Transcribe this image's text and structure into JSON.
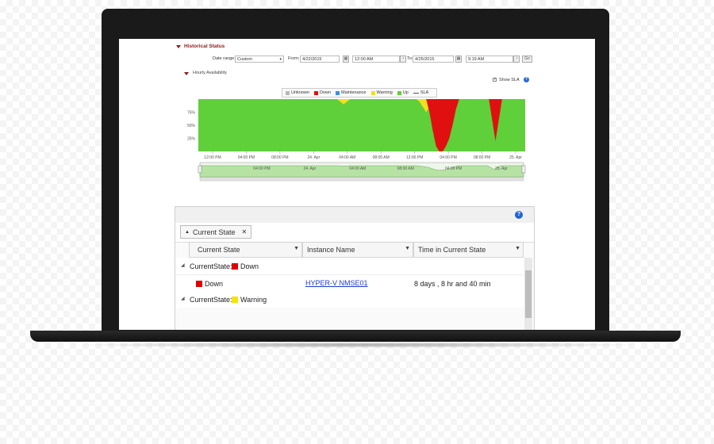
{
  "historical_status": {
    "title": "Historical Status",
    "date_range_label": "Date range:",
    "date_range_value": "Custom",
    "from_label": "From:",
    "from_date": "4/22/2015",
    "from_time": "12:00 AM",
    "to_label": "To:",
    "to_date": "4/25/2015",
    "to_time": "9:19 AM",
    "go_label": "Go"
  },
  "hourly_availability": {
    "title": "Hourly Availability",
    "show_sla_label": "Show SLA",
    "show_sla_checked": true,
    "help_icon": "?"
  },
  "chart_data": {
    "type": "area",
    "legend": [
      {
        "name": "Unknown",
        "color": "#b8b8b8"
      },
      {
        "name": "Down",
        "color": "#e01010"
      },
      {
        "name": "Maintenance",
        "color": "#3a8ee6"
      },
      {
        "name": "Warning",
        "color": "#f0e020"
      },
      {
        "name": "Up",
        "color": "#5fcf3a"
      },
      {
        "name": "SLA",
        "color": "#555555"
      }
    ],
    "y_ticks": [
      "75%",
      "50%",
      "25%"
    ],
    "ylim": [
      0,
      100
    ],
    "x_ticks": [
      "12:00 PM",
      "04:00 PM",
      "08:00 PM",
      "24. Apr",
      "04:00 AM",
      "08:00 AM",
      "12:00 PM",
      "04:00 PM",
      "08:00 PM",
      "25. Apr"
    ],
    "navigator_ticks": [
      "04:00 PM",
      "24. Apr",
      "04:00 AM",
      "08:00 AM",
      "04:00 PM",
      "25. Apr"
    ],
    "series": [
      {
        "name": "Up",
        "values": [
          100,
          100,
          100,
          100,
          100,
          100,
          100,
          100,
          100,
          100,
          100,
          100,
          100,
          100,
          100,
          100,
          100,
          100,
          100,
          100,
          100,
          100,
          100,
          100,
          100,
          100,
          100,
          100,
          100,
          100,
          100,
          100,
          100,
          100,
          100,
          100,
          100,
          100,
          100,
          100,
          100,
          100,
          100,
          100,
          100,
          100,
          100,
          100,
          100,
          100,
          100,
          100,
          100,
          100,
          100,
          100,
          100,
          100,
          100,
          100,
          100,
          100,
          100,
          100,
          100,
          100,
          100,
          100,
          100,
          100,
          100,
          100,
          100,
          100,
          100,
          100,
          100,
          100,
          100,
          100,
          100,
          100,
          100,
          100,
          100,
          100,
          100,
          100,
          100,
          100,
          100,
          100,
          100,
          100,
          100,
          100,
          100,
          100,
          100,
          100
        ]
      },
      {
        "name": "Down",
        "values": [
          0,
          0,
          0,
          0,
          0,
          0,
          0,
          0,
          0,
          0,
          0,
          0,
          0,
          0,
          0,
          0,
          0,
          0,
          0,
          0,
          0,
          0,
          0,
          0,
          0,
          0,
          0,
          0,
          0,
          0,
          0,
          0,
          0,
          0,
          0,
          0,
          0,
          0,
          0,
          0,
          0,
          0,
          0,
          0,
          0,
          0,
          0,
          0,
          0,
          0,
          0,
          0,
          0,
          0,
          0,
          0,
          0,
          0,
          0,
          0,
          0,
          0,
          0,
          0,
          0,
          0,
          0,
          0,
          0,
          0,
          25,
          60,
          90,
          100,
          100,
          90,
          75,
          50,
          20,
          0,
          0,
          0,
          0,
          0,
          0,
          0,
          0,
          0,
          0,
          40,
          80,
          40,
          0,
          0,
          0,
          0,
          0,
          0,
          0,
          0
        ]
      },
      {
        "name": "Warning",
        "values": [
          0,
          0,
          0,
          0,
          0,
          0,
          0,
          0,
          0,
          0,
          0,
          0,
          0,
          0,
          0,
          0,
          0,
          0,
          0,
          0,
          0,
          0,
          0,
          0,
          0,
          0,
          0,
          0,
          0,
          0,
          0,
          0,
          0,
          0,
          0,
          0,
          0,
          0,
          0,
          0,
          0,
          0,
          0,
          5,
          10,
          5,
          0,
          0,
          0,
          0,
          0,
          0,
          0,
          0,
          0,
          0,
          0,
          0,
          0,
          0,
          0,
          0,
          0,
          0,
          0,
          0,
          0,
          5,
          15,
          25,
          15,
          5,
          0,
          0,
          0,
          0,
          0,
          0,
          0,
          0,
          0,
          0,
          0,
          0,
          0,
          0,
          0,
          0,
          0,
          0,
          0,
          0,
          0,
          0,
          0,
          0,
          0,
          0,
          0,
          0
        ]
      }
    ]
  },
  "grid": {
    "help_icon": "?",
    "group_chip_label": "Current State",
    "group_chip_close": "✕",
    "columns": [
      "Current State",
      "Instance Name",
      "Time in Current State"
    ],
    "groups": [
      {
        "prefix": "CurrentState:",
        "state": "Down",
        "color": "#e00000",
        "rows": [
          {
            "state": "Down",
            "instance": "HYPER-V NMSE01",
            "time": "8 days , 8 hr and 40 min"
          }
        ]
      },
      {
        "prefix": "CurrentState:",
        "state": "Warning",
        "color": "#f5e400",
        "rows": []
      }
    ]
  }
}
